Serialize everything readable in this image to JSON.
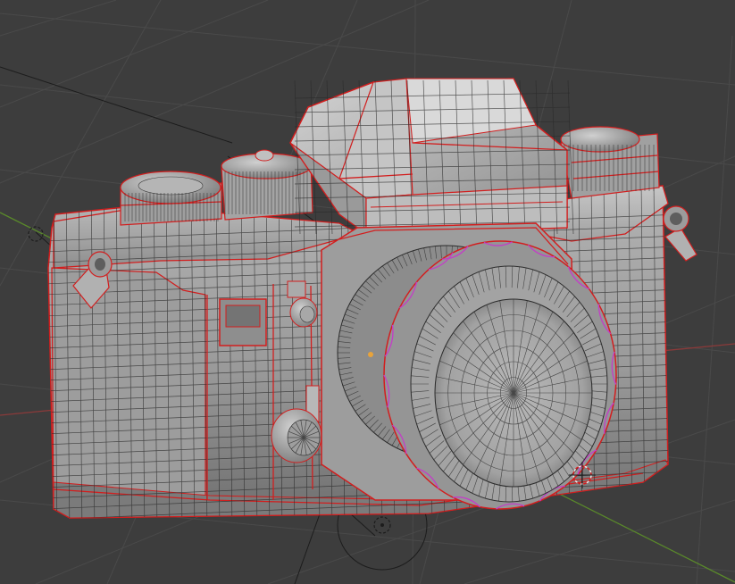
{
  "viewport": {
    "background": "#3d3d3d",
    "grid_color": "#4a4a4a",
    "x_axis_color": "#8a3a3a",
    "y_axis_color": "#5a8a2a",
    "seam_color": "#d21e1e",
    "selected_edge_color": "#c43cc8",
    "mesh_base_color": "#9a9a9a"
  },
  "scene": {
    "object": "camera-model",
    "icons": [
      "empty-marker-icon",
      "cursor-3d-icon",
      "origin-dot-icon"
    ]
  }
}
